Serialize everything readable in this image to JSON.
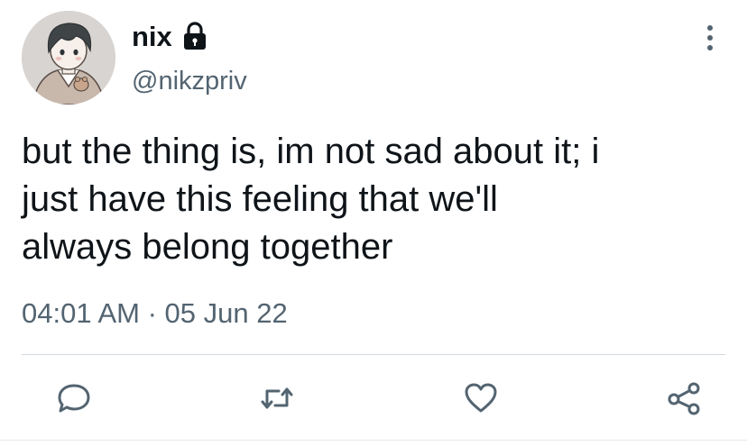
{
  "author": {
    "display_name": "nix",
    "handle": "@nikzpriv",
    "avatar_icon": "anime-boy-avatar",
    "protected_icon": "lock-icon"
  },
  "tweet": {
    "text": "but the thing is, im not sad about it; i\njust have this feeling that we'll\nalways belong together",
    "time": "04:01 AM",
    "separator": " · ",
    "date": "05 Jun 22"
  },
  "menu": {
    "icon": "more-vertical-icon"
  },
  "actions": [
    {
      "name": "reply",
      "icon": "reply-icon"
    },
    {
      "name": "retweet",
      "icon": "retweet-icon"
    },
    {
      "name": "like",
      "icon": "heart-icon"
    },
    {
      "name": "share",
      "icon": "share-icon"
    }
  ],
  "colors": {
    "text_primary": "#0f1419",
    "text_secondary": "#536471",
    "divider": "#cfd9de",
    "background": "#ffffff"
  }
}
